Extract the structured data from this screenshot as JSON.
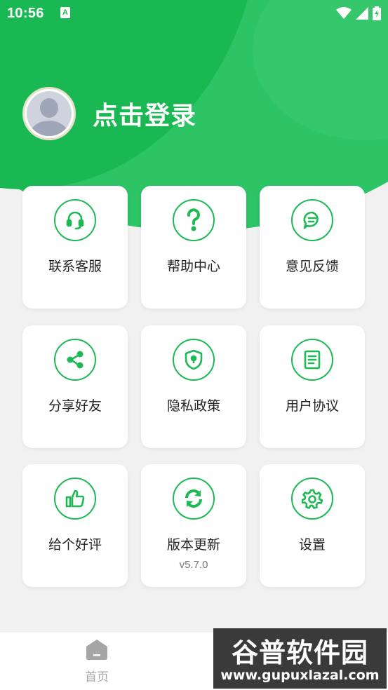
{
  "status_bar": {
    "time": "10:56",
    "notif_icon_letter": "A"
  },
  "profile": {
    "login_label": "点击登录"
  },
  "menu": [
    {
      "label": "联系客服",
      "icon": "headset-icon"
    },
    {
      "label": "帮助中心",
      "icon": "question-icon"
    },
    {
      "label": "意见反馈",
      "icon": "chat-bubble-icon"
    },
    {
      "label": "分享好友",
      "icon": "share-icon"
    },
    {
      "label": "隐私政策",
      "icon": "shield-lock-icon"
    },
    {
      "label": "用户协议",
      "icon": "document-icon"
    },
    {
      "label": "给个好评",
      "icon": "thumbs-up-icon"
    },
    {
      "label": "版本更新",
      "icon": "refresh-icon",
      "sub": "v5.7.0"
    },
    {
      "label": "设置",
      "icon": "gear-icon"
    }
  ],
  "bottom_nav": {
    "home_label": "首页"
  },
  "watermark": {
    "title": "谷普软件园",
    "url": "www.gupuxlazal.com"
  },
  "colors": {
    "accent": "#1db954",
    "hero": "#2cc465",
    "background": "#f1f1f1"
  }
}
